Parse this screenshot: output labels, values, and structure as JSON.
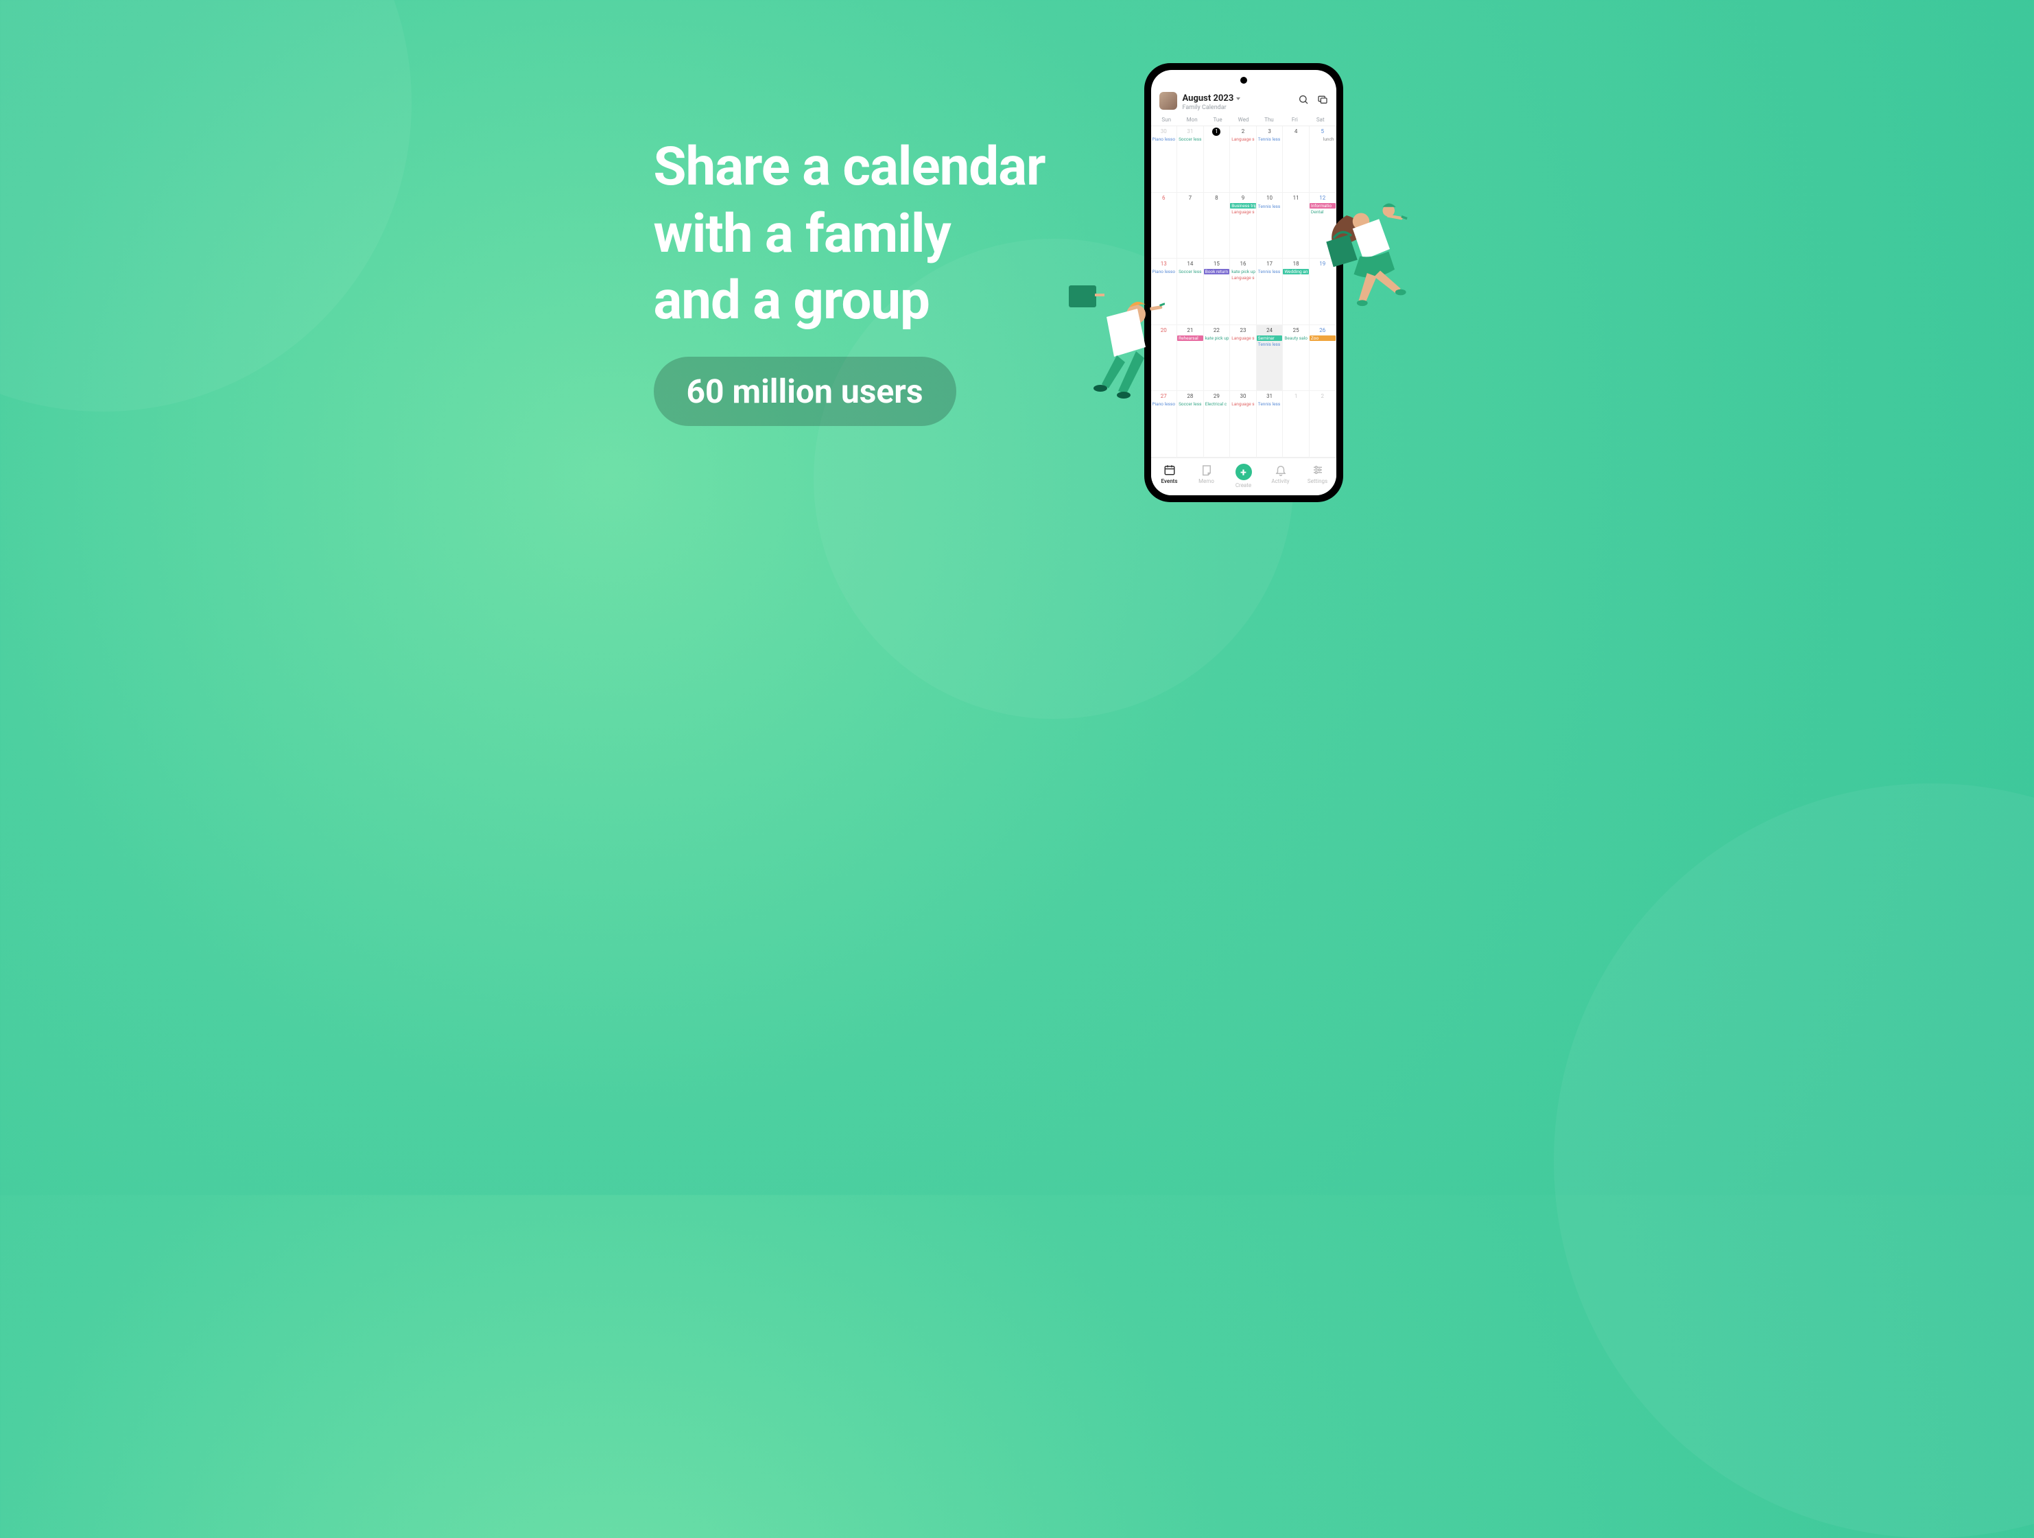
{
  "headline": {
    "line1": "Share a calendar",
    "line2": "with a family",
    "line3": "and a group"
  },
  "pill": {
    "text": "60 million users"
  },
  "app": {
    "month": "August 2023",
    "subtitle": "Family Calendar",
    "dow": [
      "Sun",
      "Mon",
      "Tue",
      "Wed",
      "Thu",
      "Fri",
      "Sat"
    ]
  },
  "weeks": [
    [
      {
        "n": "30",
        "cls": "out",
        "events": [
          {
            "t": "Piano lesso",
            "c": "blue"
          }
        ]
      },
      {
        "n": "31",
        "cls": "out",
        "events": [
          {
            "t": "Soccer less",
            "c": "green"
          }
        ]
      },
      {
        "n": "1",
        "cls": "today",
        "events": []
      },
      {
        "n": "2",
        "events": [
          {
            "t": "Language s",
            "c": "red"
          }
        ]
      },
      {
        "n": "3",
        "events": [
          {
            "t": "Tennis less",
            "c": "blue"
          }
        ]
      },
      {
        "n": "4",
        "events": []
      },
      {
        "n": "5",
        "cls": "sat",
        "events": [
          {
            "t": "lunch",
            "c": "gray"
          }
        ]
      }
    ],
    [
      {
        "n": "6",
        "cls": "sun",
        "events": []
      },
      {
        "n": "7",
        "events": []
      },
      {
        "n": "8",
        "events": [
          {
            "t": "",
            "c": "teal"
          }
        ]
      },
      {
        "n": "9",
        "events": [
          {
            "t": "Business trip",
            "c": "teal"
          },
          {
            "t": "Language s",
            "c": "red"
          }
        ]
      },
      {
        "n": "10",
        "events": [
          {
            "t": "",
            "c": "teal"
          },
          {
            "t": "Tennis less",
            "c": "blue"
          }
        ]
      },
      {
        "n": "11",
        "events": []
      },
      {
        "n": "12",
        "cls": "sat",
        "events": [
          {
            "t": "Informatio",
            "c": "pink"
          },
          {
            "t": "Dental",
            "c": "green"
          }
        ]
      }
    ],
    [
      {
        "n": "13",
        "cls": "sun",
        "events": [
          {
            "t": "Piano lesso",
            "c": "blue"
          }
        ]
      },
      {
        "n": "14",
        "events": [
          {
            "t": "Soccer less",
            "c": "green"
          }
        ]
      },
      {
        "n": "15",
        "events": [
          {
            "t": "Book return",
            "c": "purple"
          }
        ]
      },
      {
        "n": "16",
        "events": [
          {
            "t": "kate pick up",
            "c": "txt"
          },
          {
            "t": "Language s",
            "c": "red"
          }
        ]
      },
      {
        "n": "17",
        "events": [
          {
            "t": "Tennis less",
            "c": "blue"
          }
        ]
      },
      {
        "n": "18",
        "events": [
          {
            "t": "Wedding an",
            "c": "teal"
          }
        ]
      },
      {
        "n": "19",
        "cls": "sat",
        "events": []
      }
    ],
    [
      {
        "n": "20",
        "cls": "sun",
        "events": []
      },
      {
        "n": "21",
        "events": [
          {
            "t": "Rehearsal",
            "c": "pink"
          }
        ]
      },
      {
        "n": "22",
        "events": [
          {
            "t": "kate pick up",
            "c": "txt"
          }
        ]
      },
      {
        "n": "23",
        "events": [
          {
            "t": "Language s",
            "c": "red"
          }
        ]
      },
      {
        "n": "24",
        "cls": "hl",
        "events": [
          {
            "t": "Seminar",
            "c": "teal"
          },
          {
            "t": "Tennis less",
            "c": "blue"
          }
        ]
      },
      {
        "n": "25",
        "events": [
          {
            "t": "Beauty salo",
            "c": "txt"
          }
        ]
      },
      {
        "n": "26",
        "cls": "sat",
        "events": [
          {
            "t": "Zoo",
            "c": "orange"
          }
        ]
      }
    ],
    [
      {
        "n": "27",
        "cls": "sun",
        "events": [
          {
            "t": "Piano lesso",
            "c": "blue"
          }
        ]
      },
      {
        "n": "28",
        "events": [
          {
            "t": "Soccer less",
            "c": "green"
          }
        ]
      },
      {
        "n": "29",
        "events": [
          {
            "t": "Electrical c",
            "c": "txt"
          }
        ]
      },
      {
        "n": "30",
        "events": [
          {
            "t": "Language s",
            "c": "red"
          }
        ]
      },
      {
        "n": "31",
        "events": [
          {
            "t": "Tennis less",
            "c": "blue"
          }
        ]
      },
      {
        "n": "1",
        "cls": "out",
        "events": []
      },
      {
        "n": "2",
        "cls": "out",
        "events": []
      }
    ]
  ],
  "tabs": {
    "events": "Events",
    "memo": "Memo",
    "create": "Create",
    "activity": "Activity",
    "settings": "Settings"
  }
}
